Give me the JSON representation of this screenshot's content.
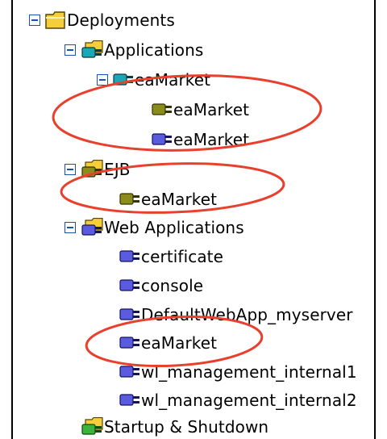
{
  "colors": {
    "toggle": "#1a4fb5",
    "folder": "#f4cf3a",
    "annotation": "#e8402c"
  },
  "tree": {
    "deployments": "Deployments",
    "applications": "Applications",
    "app_eamarket": "eaMarket",
    "app_eamarket_ejb": "eaMarket",
    "app_eamarket_web": "eaMarket",
    "ejb": "EJB",
    "ejb_eamarket": "eaMarket",
    "web_applications": "Web Applications",
    "web_certificate": "certificate",
    "web_console": "console",
    "web_default": "DefaultWebApp_myserver",
    "web_eamarket": "eaMarket",
    "web_wl1": "wl_management_internal1",
    "web_wl2": "wl_management_internal2",
    "startup_shutdown": "Startup & Shutdown"
  },
  "icons": {
    "deployments": "folder-icon",
    "applications": "application-folder-icon",
    "ejb": "ejb-folder-icon",
    "web_applications": "web-folder-icon",
    "startup_shutdown": "startup-folder-icon",
    "module": "module-icon"
  }
}
